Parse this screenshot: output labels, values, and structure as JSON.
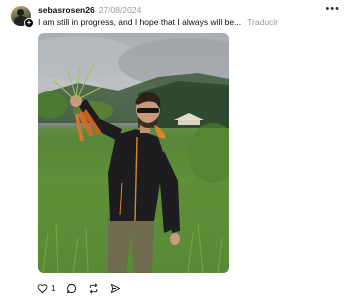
{
  "post": {
    "username": "sebasrosen26",
    "date": "27/08/2024",
    "caption": "I am still in progress, and I hope that I always will be...",
    "translate_label": "Traducir",
    "more_icon": "more-horizontal-icon",
    "like_count": "1"
  },
  "icons": [
    "heart-icon",
    "comment-icon",
    "repost-icon",
    "share-icon"
  ]
}
